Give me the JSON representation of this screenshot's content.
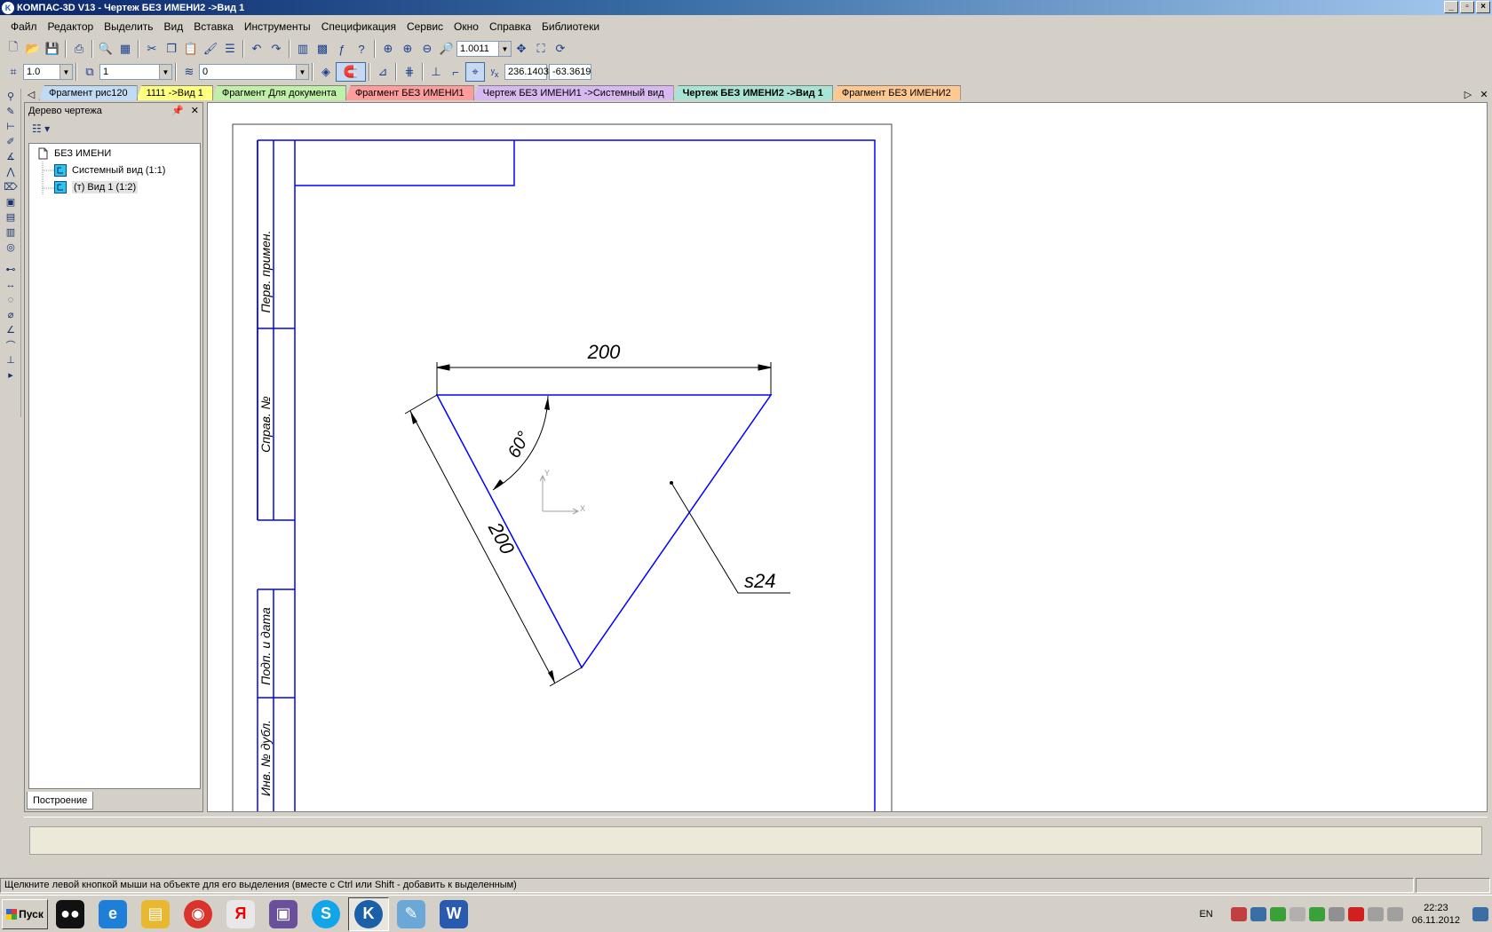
{
  "window": {
    "title": "КОМПАС-3D V13 - Чертеж БЕЗ ИМЕНИ2 ->Вид 1",
    "app_icon": "kompas-logo"
  },
  "menu": [
    "Файл",
    "Редактор",
    "Выделить",
    "Вид",
    "Вставка",
    "Инструменты",
    "Спецификация",
    "Сервис",
    "Окно",
    "Справка",
    "Библиотеки"
  ],
  "toolbar_standard": {
    "zoom_value": "1.0011"
  },
  "toolbar_current_state": {
    "grid_step": "1.0",
    "view_number": "1",
    "layer_number": "0",
    "coord_x": "236.1403",
    "coord_y": "-63.3619"
  },
  "tabs": [
    {
      "label": "Фрагмент рис120",
      "color": "#c0dcf4",
      "active": false
    },
    {
      "label": "1111 ->Вид 1",
      "color": "#ffff80",
      "active": false
    },
    {
      "label": "Фрагмент Для документа",
      "color": "#c0f0a8",
      "active": false
    },
    {
      "label": "Фрагмент БЕЗ ИМЕНИ1",
      "color": "#ff9c9c",
      "active": false
    },
    {
      "label": "Чертеж БЕЗ ИМЕНИ1 ->Системный вид",
      "color": "#d8b8f0",
      "active": false
    },
    {
      "label": "Чертеж БЕЗ ИМЕНИ2 ->Вид 1",
      "color": "#a8e4d4",
      "active": true
    },
    {
      "label": "Фрагмент БЕЗ ИМЕНИ2",
      "color": "#ffc890",
      "active": false
    }
  ],
  "tree": {
    "title": "Дерево чертежа",
    "root": "БЕЗ ИМЕНИ",
    "items": [
      "Системный вид (1:1)",
      "(т) Вид 1 (1:2)"
    ],
    "tab_label": "Построение"
  },
  "drawing": {
    "stamp_labels": [
      "Перв. примен.",
      "Справ. №",
      "Подп. и дата",
      "Инв. № дубл."
    ],
    "dim_top": "200",
    "dim_side": "200",
    "dim_angle": "60°",
    "leader_label": "s24",
    "axis_x": "X",
    "axis_y": "Y",
    "line_color": "#0000ff"
  },
  "status": {
    "text": "Щелкните левой кнопкой мыши на объекте для его выделения (вместе с Ctrl или Shift - добавить к выделенным)"
  },
  "taskbar": {
    "start_label": "Пуск",
    "lang": "EN",
    "time": "22:23",
    "date": "06.11.2012",
    "apps": [
      {
        "name": "taskbar-app-owl-icon",
        "color": "#111111",
        "glyph": "●●"
      },
      {
        "name": "taskbar-ie-icon",
        "color": "#1e7fd8",
        "glyph": "e"
      },
      {
        "name": "taskbar-explorer-icon",
        "color": "#e8b830",
        "glyph": "▤"
      },
      {
        "name": "taskbar-chrome-icon",
        "color": "#d9342b",
        "glyph": "◉"
      },
      {
        "name": "taskbar-yandex-icon",
        "color": "#e8e8e8",
        "glyph": "Я"
      },
      {
        "name": "taskbar-save-icon",
        "color": "#6a4f9a",
        "glyph": "▣"
      },
      {
        "name": "taskbar-skype-icon",
        "color": "#12a5e8",
        "glyph": "S"
      },
      {
        "name": "taskbar-kompas-icon",
        "color": "#1a5fa8",
        "glyph": "K"
      },
      {
        "name": "taskbar-paint-icon",
        "color": "#6aa8d8",
        "glyph": "✎"
      },
      {
        "name": "taskbar-word-icon",
        "color": "#2a5ab0",
        "glyph": "W"
      }
    ]
  }
}
